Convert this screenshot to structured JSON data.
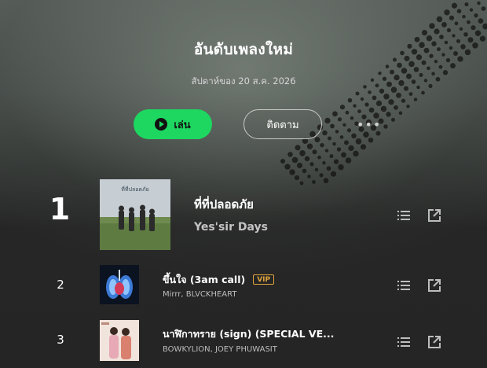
{
  "header": {
    "title": "อันดับเพลงใหม่",
    "subtitle": "สัปดาห์ของ 20 ส.ค. 2026"
  },
  "actions": {
    "play_label": "เล่น",
    "follow_label": "ติดตาม",
    "more_label": "•••"
  },
  "colors": {
    "accent_green": "#1ed760",
    "vip_orange": "#e0a33b",
    "background": "#262626"
  },
  "tracks": [
    {
      "rank": "1",
      "title": "ที่ที่ปลอดภัย",
      "artists": "Yes'sir Days",
      "cover_text": "ที่ที่ปลอดภัย",
      "vip": ""
    },
    {
      "rank": "2",
      "title": "ขึ้นใจ (3am call)",
      "artists": "Mirrr,  BLVCKHEART",
      "vip": "VIP"
    },
    {
      "rank": "3",
      "title": "นาฬิกาทราย (sign) (SPECIAL VE...",
      "artists": "BOWKYLION,  JOEY PHUWASIT",
      "vip": ""
    }
  ],
  "icons": [
    "play-icon",
    "queue-icon",
    "share-icon",
    "more-icon"
  ]
}
